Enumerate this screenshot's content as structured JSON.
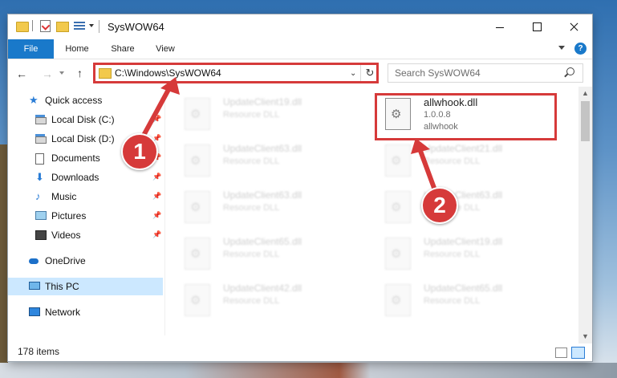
{
  "window": {
    "title": "SysWOW64",
    "status": "178 items",
    "controls": {
      "minimize_icon": "minimize-icon",
      "maximize_icon": "maximize-icon",
      "close_icon": "close-icon"
    }
  },
  "ribbon": {
    "tabs": [
      "File",
      "Home",
      "Share",
      "View"
    ],
    "help": "?"
  },
  "navigation": {
    "address": "C:\\Windows\\SysWOW64",
    "search_placeholder": "Search SysWOW64"
  },
  "sidebar": {
    "items": [
      {
        "label": "Quick access",
        "icon": "star-icon"
      },
      {
        "label": "Local Disk (C:)",
        "icon": "disk-icon",
        "pinned": true
      },
      {
        "label": "Local Disk (D:)",
        "icon": "disk-icon",
        "pinned": true
      },
      {
        "label": "Documents",
        "icon": "document-icon",
        "pinned": true
      },
      {
        "label": "Downloads",
        "icon": "download-icon",
        "pinned": true
      },
      {
        "label": "Music",
        "icon": "music-icon",
        "pinned": true
      },
      {
        "label": "Pictures",
        "icon": "picture-icon",
        "pinned": true
      },
      {
        "label": "Videos",
        "icon": "video-icon",
        "pinned": true
      },
      {
        "label": "OneDrive",
        "icon": "cloud-icon"
      },
      {
        "label": "This PC",
        "icon": "computer-icon",
        "selected": true
      },
      {
        "label": "Network",
        "icon": "network-icon"
      }
    ]
  },
  "files": {
    "left_column": [
      {
        "name": "UpdateClient19.dll",
        "type": "Resource DLL"
      },
      {
        "name": "UpdateClient63.dll",
        "type": "Resource DLL"
      },
      {
        "name": "UpdateClient63.dll",
        "type": "Resource DLL"
      },
      {
        "name": "UpdateClient65.dll",
        "type": "Resource DLL"
      },
      {
        "name": "UpdateClient42.dll",
        "type": "Resource DLL"
      }
    ],
    "right_column": [
      {
        "name": "allwhook.dll",
        "type": "1.0.0.8",
        "sub": "allwhook"
      },
      {
        "name": "UpdateClient21.dll",
        "type": "Resource DLL"
      },
      {
        "name": "UpdateClient63.dll",
        "type": "Resource DLL"
      },
      {
        "name": "UpdateClient19.dll",
        "type": "Resource DLL"
      },
      {
        "name": "UpdateClient65.dll",
        "type": "Resource DLL"
      }
    ]
  },
  "annotations": {
    "step1": "1",
    "step2": "2",
    "color": "#d63a3a"
  }
}
